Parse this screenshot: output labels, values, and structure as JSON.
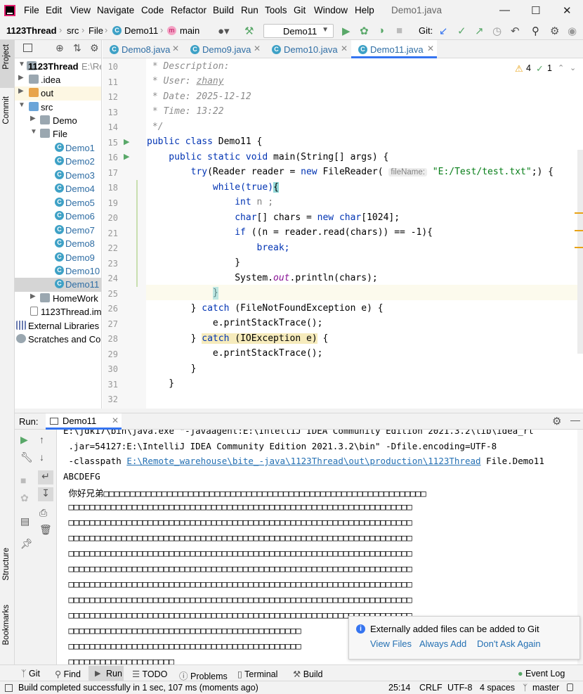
{
  "menu": {
    "items": [
      "File",
      "Edit",
      "View",
      "Navigate",
      "Code",
      "Refactor",
      "Build",
      "Run",
      "Tools",
      "Git",
      "Window",
      "Help"
    ],
    "window_title": "Demo1.java"
  },
  "navbar": {
    "project": "1123Thread",
    "crumbs": [
      "src",
      "File",
      "Demo11",
      "main"
    ],
    "run_config": "Demo11",
    "git_label": "Git:"
  },
  "left_strip": {
    "project": "Project",
    "commit": "Commit",
    "structure": "Structure",
    "bookmarks": "Bookmarks"
  },
  "project_tree": {
    "root": "1123Thread",
    "root_path": "E:\\Re",
    "idea": ".idea",
    "out": "out",
    "src": "src",
    "demo": "Demo",
    "file": "File",
    "classes": [
      "Demo1",
      "Demo2",
      "Demo3",
      "Demo4",
      "Demo5",
      "Demo6",
      "Demo7",
      "Demo8",
      "Demo9",
      "Demo10",
      "Demo11"
    ],
    "homework": "HomeWork",
    "iml": "1123Thread.iml",
    "external": "External Libraries",
    "scratches": "Scratches and Cons"
  },
  "tabs": [
    "Demo8.java",
    "Demo9.java",
    "Demo10.java",
    "Demo11.java"
  ],
  "inspections": {
    "warnings": "4",
    "ok": "1"
  },
  "code": {
    "line_numbers": [
      "10",
      "11",
      "12",
      "13",
      "14",
      "15",
      "16",
      "17",
      "18",
      "19",
      "20",
      "21",
      "22",
      "23",
      "24",
      "25",
      "26",
      "27",
      "28",
      "29",
      "30",
      "31",
      "32"
    ],
    "l10": " * Description:",
    "l11a": " * User: ",
    "l11b": "zhany",
    "l12": " * Date: 2025-12-12",
    "l13": " * Time: 13:22",
    "l14": " */",
    "l15a": "public class ",
    "l15b": "Demo11 {",
    "l16a": "    public static void ",
    "l16b": "main(String[] args) {",
    "l17a": "        try",
    "l17b": "(Reader reader = ",
    "l17c": "new ",
    "l17d": "FileReader( ",
    "l17hint": "fileName:",
    "l17e": " \"E:/Test/test.txt\"",
    "l17f": ";) {",
    "l18a": "            while",
    "l18b": "(true)",
    "l18c": "{",
    "l19a": "                int ",
    "l19b": "n ;",
    "l20a": "                char",
    "l20b": "[] chars = ",
    "l20c": "new char",
    "l20d": "[1024];",
    "l21a": "                if ",
    "l21b": "((n = reader.read(chars)) == -1){",
    "l22": "                    break;",
    "l23": "                }",
    "l24a": "                System.",
    "l24b": "out",
    "l24c": ".println(chars);",
    "l25": "            }",
    "l26a": "        } ",
    "l26b": "catch ",
    "l26c": "(FileNotFoundException e) {",
    "l27": "            e.printStackTrace();",
    "l28a": "        } ",
    "l28b": "catch ",
    "l28c": "(IOException e)",
    "l28d": " {",
    "l29": "            e.printStackTrace();",
    "l30": "        }",
    "l31": "    }",
    "l32": ""
  },
  "run": {
    "label": "Run:",
    "tab": "Demo11",
    "cmd1": "E:\\jdk17\\bin\\java.exe \"-javaagent:E:\\IntelliJ IDEA Community Edition 2021.3.2\\lib\\idea_rt",
    "cmd2": " .jar=54127:E:\\IntelliJ IDEA Community Edition 2021.3.2\\bin\" -Dfile.encoding=UTF-8",
    "cmd3a": " -classpath ",
    "cmd3b": "E:\\Remote_warehouse\\bite_-java\\1123Thread\\out\\production\\1123Thread",
    "cmd3c": " File.Demo11",
    "out1": "ABCDEFG",
    "out2": " 你好兄弟□□□□□□□□□□□□□□□□□□□□□□□□□□□□□□□□□□□□□□□□□□□□□□□□□□□□□□□□□□□□□",
    "garbage": " □□□□□□□□□□□□□□□□□□□□□□□□□□□□□□□□□□□□□□□□□□□□□□□□□□□□□□□□□□□□□□□□□",
    "garbage_short": " □□□□□□□□□□□□□□□□□□□□□□□□□□□□□□□□□□□□□□□□□□□□",
    "last": " □□□□□□□□□□□□□□□□□□□□"
  },
  "notification": {
    "text": "Externally added files can be added to Git",
    "view": "View Files",
    "always": "Always Add",
    "dont": "Don't Ask Again"
  },
  "tool_windows": [
    "Git",
    "Find",
    "Run",
    "TODO",
    "Problems",
    "Terminal",
    "Build"
  ],
  "event_log": "Event Log",
  "status": {
    "message": "Build completed successfully in 1 sec, 107 ms (moments ago)",
    "position": "25:14",
    "line_sep": "CRLF",
    "encoding": "UTF-8",
    "indent": "4 spaces",
    "branch": "master"
  },
  "colors": {
    "accent": "#3574f0",
    "keyword": "#0033b3",
    "string": "#067d17",
    "comment": "#8c8c8c",
    "class_icon": "#3ea1c6",
    "run_green": "#59a869"
  }
}
